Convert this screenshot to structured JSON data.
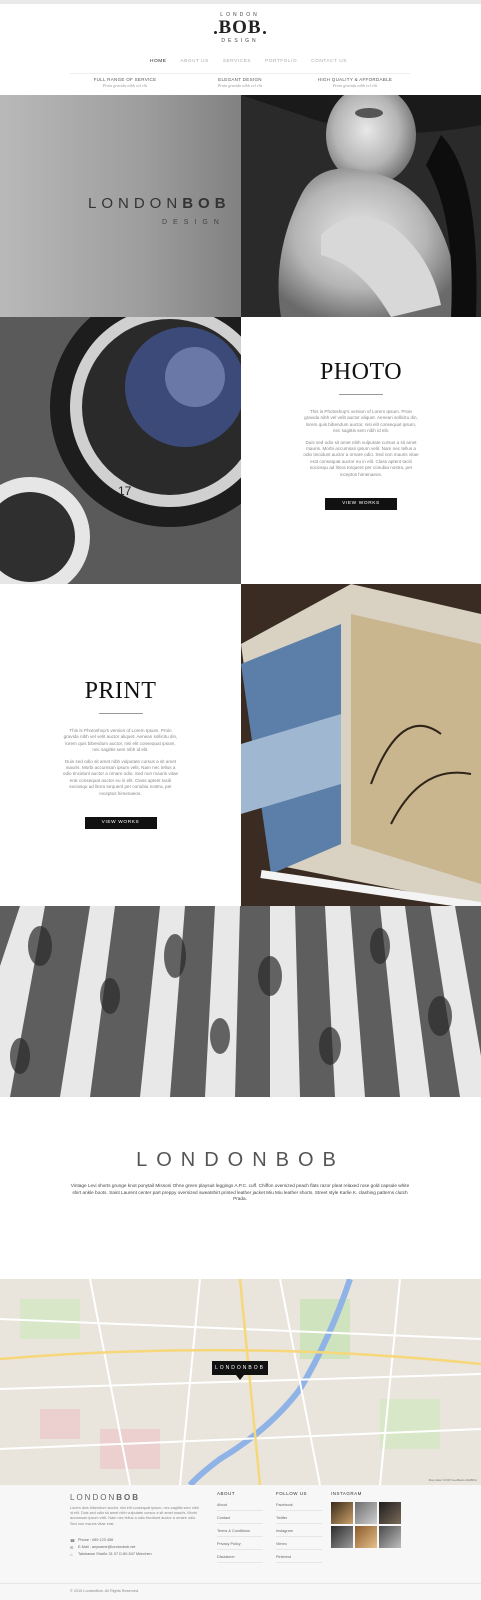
{
  "logo": {
    "top": "LONDON",
    "main": "BOB",
    "bottom": "DESIGN"
  },
  "nav": [
    "HOME",
    "ABOUT US",
    "SERVICES",
    "PORTFOLIO",
    "CONTACT US"
  ],
  "features": [
    {
      "title": "FULL RANGE OF SERVICE",
      "sub": "Proin gravida nibh vel elit"
    },
    {
      "title": "ELEGANT DESIGN",
      "sub": "Proin gravida nibh vel elit"
    },
    {
      "title": "HIGH QUALITY & AFFORDABLE",
      "sub": "Proin gravida nibh vel elit"
    }
  ],
  "hero": {
    "brand_light": "LONDON",
    "brand_bold": "BOB",
    "sub": "DESIGN"
  },
  "photo": {
    "title": "PHOTO",
    "text1": "This is Photoshop's version of Lorem Ipsum. Proin gravida nibh vel velit auctor aliquet. Aenean sollicitu din, lorem quis bibendum auctor, nisi elit consequat ipsum, nec sagittis sem nibh id elit.",
    "text2": "Duis sed odio sit amet nibh vulputate cursus a sit amet mauris. Morbi accumsan ipsum velit. Nam nec tellus a odio tincidunt auctor a ornare odio. Sed non mauris vitae erat consequat auctor eu in elit. Class aptent taciti sociosqu ad litora torquent per conubia nostra, per inceptos himenaeos.",
    "button": "VIEW WORKS"
  },
  "print": {
    "title": "PRINT",
    "text1": "This is Photoshop's version of Lorem Ipsum. Proin gravida nibh vel velit auctor aliquet. Aenean sollicitu din, lorem quis bibendum auctor, nisi elit consequat ipsum, nec sagittis sem nibh id elit.",
    "text2": "Duis sed odio sit amet nibh vulputate cursus a sit amet mauris. Morbi accumsan ipsum velit. Nam nec tellus a odio tincidunt auctor a ornare odio. Sed non mauris vitae erat consequat auctor eu in elit. Class aptent taciti sociosqu ad litora torquent per conubia nostra, per inceptos himenaeos.",
    "button": "VIEW WORKS"
  },
  "brand_section": {
    "title": "LONDONBOB",
    "text": "Vintage Levi shorts grunge knot ponytail Missoni Ohne green playsuit leggings A.P.C. cuff. Chiffon oversized peach flats razor pleat relaxed rose gold capsule white shirt ankle boots. Saint Laurent center part preppy oversized sweatshirt printed leather jacket Miu Miu leather shorts. Street style Karlie K. clashing patterns clutch Prada."
  },
  "map": {
    "marker": "LONDONBOB",
    "copyright": "Map data ©2015 GeoBasis-DE/BKG"
  },
  "footer": {
    "brand_light": "LONDON",
    "brand_bold": "BOB",
    "about": "Lorem duis bibendum auctor, nisi elit consequat ipsum, nec sagittis sem nibh id elit. Duis sed odio sit amet nibh vulputate cursus a sit amet mauris. Morbi accumsan ipsum velit. Nam nec tellus a odio tincidunt auctor a ornare odio. Sed non mauris vitae erat.",
    "phone": "Phone : 089 123 456",
    "email": "E-Mail : anyname@londonbob.net",
    "address": "Talstrasse Straße 31 07 D-80-547 München",
    "about_title": "ABOUT",
    "about_links": [
      "About",
      "Contact",
      "Terms & Conditions",
      "Privacy Policy",
      "Disclaimer"
    ],
    "follow_title": "FOLLOW US",
    "follow_links": [
      "Facebook",
      "Twitter",
      "Instagram",
      "Vimeo",
      "Pinterest"
    ],
    "instagram_title": "INSTAGRAM",
    "copyright": "© 2015 LondonBob. All Rights Reserved."
  }
}
